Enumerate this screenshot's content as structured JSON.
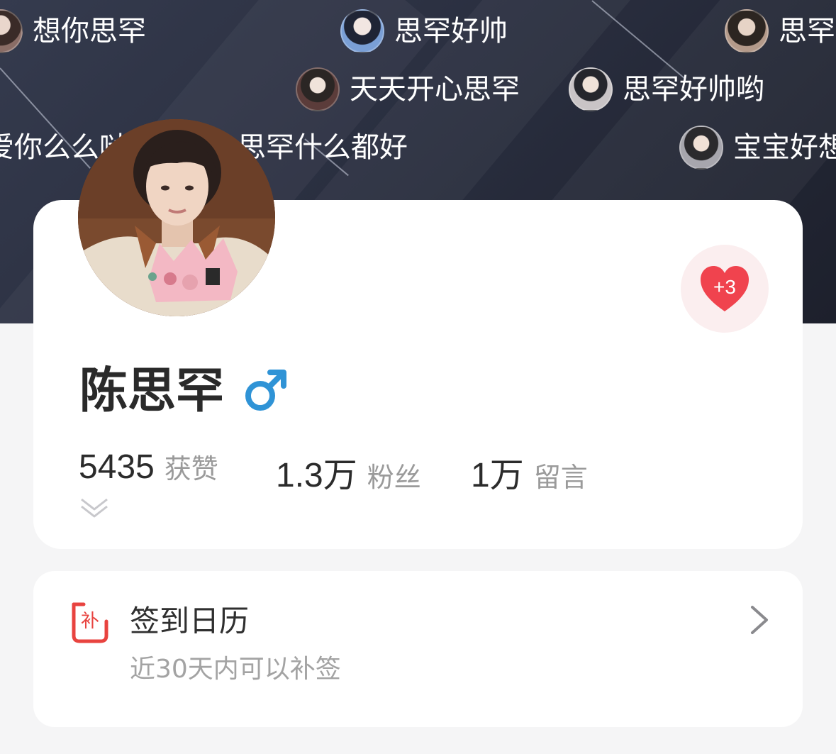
{
  "danmaku": [
    {
      "text": "想你思罕",
      "avatar": "fan-avatar-1"
    },
    {
      "text": "思罕好帅",
      "avatar": "fan-avatar-2"
    },
    {
      "text": "思罕",
      "avatar": "fan-avatar-3"
    },
    {
      "text": "天天开心思罕",
      "avatar": "fan-avatar-4"
    },
    {
      "text": "思罕好帅哟",
      "avatar": "fan-avatar-5"
    },
    {
      "text": "爱你么么哒",
      "avatar": ""
    },
    {
      "text": "思罕什么都好",
      "avatar": ""
    },
    {
      "text": "宝宝好想",
      "avatar": "fan-avatar-6"
    }
  ],
  "profile": {
    "name": "陈思罕",
    "gender_symbol": "♂",
    "gender_color": "#2f93d6",
    "like_badge": "+3",
    "like_color": "#f0434e",
    "stats": [
      {
        "value": "5435",
        "label": "获赞"
      },
      {
        "value": "1.3万",
        "label": "粉丝"
      },
      {
        "value": "1万",
        "label": "留言"
      }
    ]
  },
  "calendar": {
    "icon_char": "补",
    "icon_color": "#e8433f",
    "title": "签到日历",
    "subtitle": "近30天内可以补签"
  }
}
